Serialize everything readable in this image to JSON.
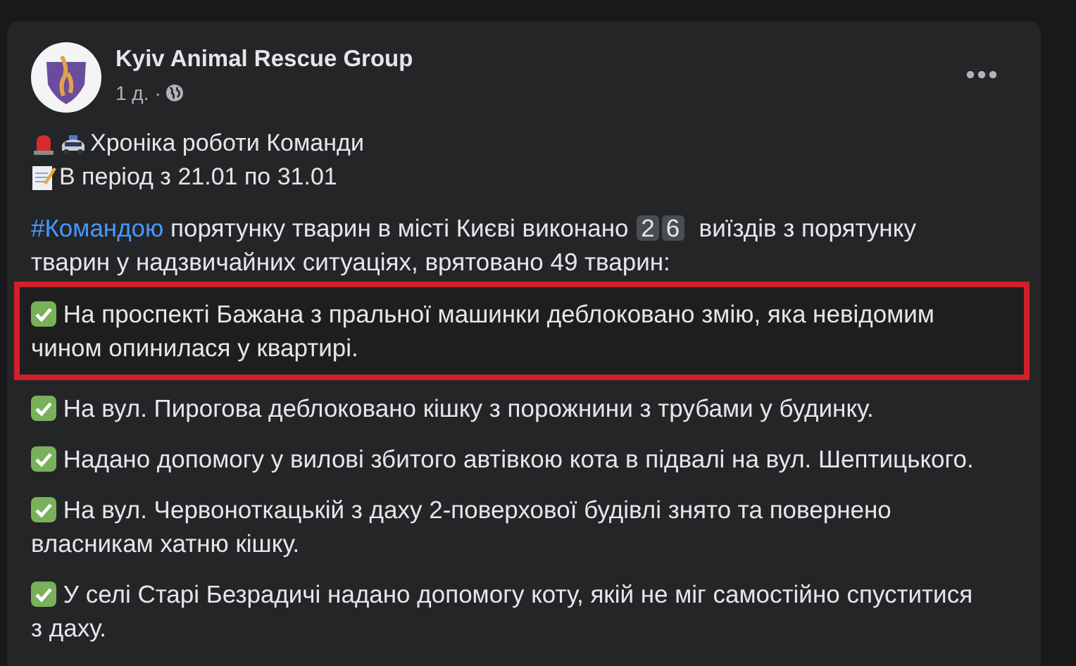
{
  "post": {
    "author": "Kyiv Animal Rescue Group",
    "time": "1 д.",
    "separator": "·",
    "heading_lines": [
      {
        "kind": "alarm",
        "text": "Хроніка роботи Команди"
      },
      {
        "kind": "memo",
        "text": "В період з 21.01 по 31.01"
      }
    ],
    "intro": {
      "hashtag": "#Командою",
      "before_keys": "порятунку тварин в місті Києві виконано",
      "keys": [
        "2",
        "6"
      ],
      "after_keys": "виїздів з порятунку тварин у надзвичайних ситуаціях, врятовано 49  тварин:"
    },
    "items": [
      {
        "text": "На проспекті Бажана з пральної машинки деблоковано змію, яка невідомим чином опинилася у квартирі.",
        "highlighted": true
      },
      {
        "text": "На вул. Пирогова деблоковано кішку з порожнини з трубами у будинку.",
        "highlighted": false
      },
      {
        "text": "Надано допомогу у вилові збитого автівкою кота в підвалі на вул. Шептицького.",
        "highlighted": false
      },
      {
        "text": "На вул. Червоноткацькій з даху 2-поверхової будівлі знято та повернено власникам хатню кішку.",
        "highlighted": false
      },
      {
        "text": "У селі Старі Безрадичі надано допомогу коту, якій не міг самостійно спуститися з даху.",
        "highlighted": false
      }
    ]
  }
}
